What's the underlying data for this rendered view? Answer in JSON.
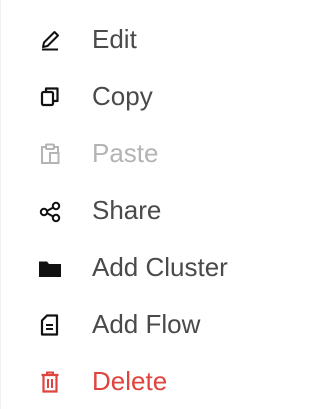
{
  "menu": {
    "items": [
      {
        "label": "Edit",
        "icon": "pencil-icon",
        "state": "enabled"
      },
      {
        "label": "Copy",
        "icon": "copy-icon",
        "state": "enabled"
      },
      {
        "label": "Paste",
        "icon": "clipboard-paste-icon",
        "state": "disabled"
      },
      {
        "label": "Share",
        "icon": "share-icon",
        "state": "enabled"
      },
      {
        "label": "Add Cluster",
        "icon": "folder-icon",
        "state": "enabled"
      },
      {
        "label": "Add Flow",
        "icon": "document-icon",
        "state": "enabled"
      },
      {
        "label": "Delete",
        "icon": "trash-icon",
        "state": "danger"
      }
    ]
  },
  "colors": {
    "text": "#4a4a4a",
    "icon": "#111111",
    "disabled": "#b4b4b4",
    "danger": "#e0443e",
    "background": "#ffffff"
  }
}
